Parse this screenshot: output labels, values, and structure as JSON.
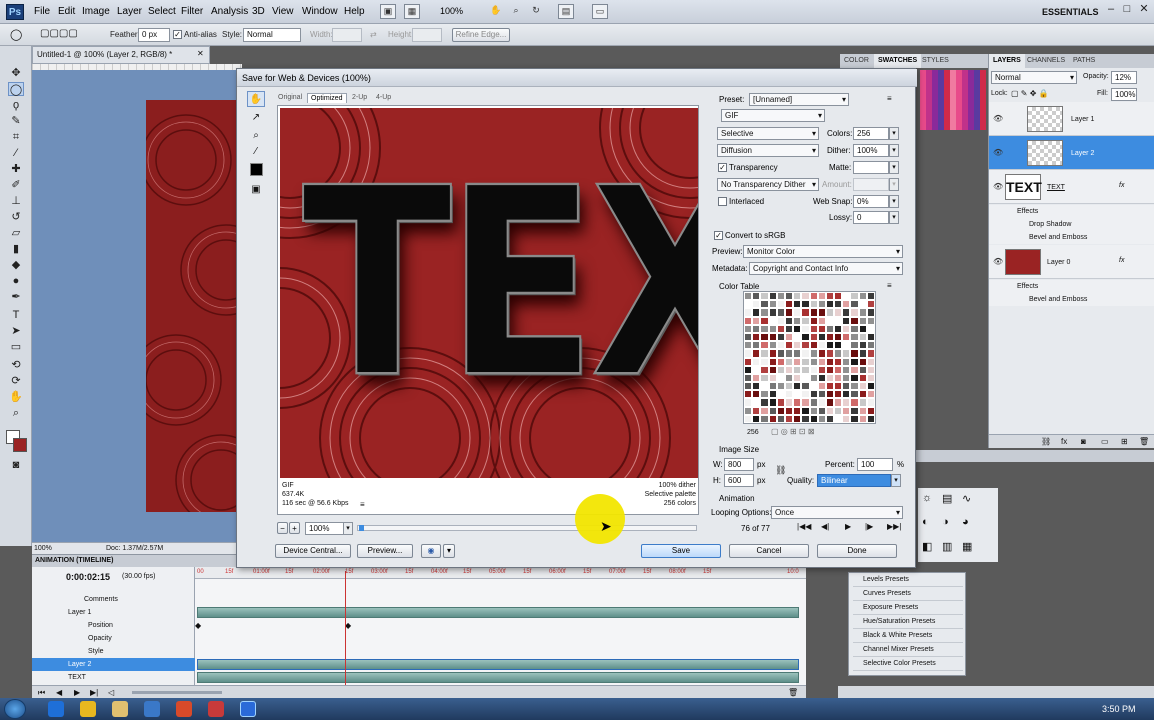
{
  "menubar": {
    "logo": "Ps",
    "items": [
      "File",
      "Edit",
      "Image",
      "Layer",
      "Select",
      "Filter",
      "Analysis",
      "3D",
      "View",
      "Window",
      "Help"
    ],
    "zoom": "100%",
    "workspace": "ESSENTIALS"
  },
  "options": {
    "feather_label": "Feather:",
    "feather_value": "0 px",
    "antialias_label": "Anti-alias",
    "style_label": "Style:",
    "style_value": "Normal",
    "width_label": "Width:",
    "height_label": "Height:",
    "refine_edge": "Refine Edge..."
  },
  "document": {
    "tab": "Untitled-1 @ 100% (Layer 2, RGB/8) *",
    "status_zoom": "100%",
    "status_doc": "Doc: 1.37M/2.57M"
  },
  "animation": {
    "title": "ANIMATION (TIMELINE)",
    "timecode": "0:00:02:15",
    "fps": "(30.00 fps)",
    "ruler_ticks": [
      "00",
      "15f",
      "01:00f",
      "15f",
      "02:00f",
      "15f",
      "03:00f",
      "15f",
      "04:00f",
      "15f",
      "05:00f",
      "15f",
      "06:00f",
      "15f",
      "07:00f",
      "15f",
      "08:00f",
      "15f",
      "10:0"
    ],
    "rows": [
      {
        "label": "Comments",
        "indent": 2
      },
      {
        "label": "Layer 1",
        "indent": 1
      },
      {
        "label": "Position",
        "indent": 2
      },
      {
        "label": "Opacity",
        "indent": 2
      },
      {
        "label": "Style",
        "indent": 2
      },
      {
        "label": "Layer 2",
        "indent": 1
      },
      {
        "label": "TEXT",
        "indent": 1
      }
    ]
  },
  "layers_panel": {
    "tabs": [
      "LAYERS",
      "CHANNELS",
      "PATHS"
    ],
    "blend_mode": "Normal",
    "opacity_label": "Opacity:",
    "opacity_value": "12%",
    "lock_label": "Lock:",
    "fill_label": "Fill:",
    "fill_value": "100%",
    "layers": [
      {
        "name": "Layer 1",
        "selected": false
      },
      {
        "name": "Layer 2",
        "selected": true
      },
      {
        "name": "TEXT",
        "selected": false
      },
      {
        "name": "Layer 0",
        "selected": false
      }
    ],
    "text_effects": [
      "Effects",
      "Drop Shadow",
      "Bevel and Emboss"
    ],
    "layer0_effects": [
      "Effects",
      "Bevel and Emboss"
    ]
  },
  "top_panel_tabs": [
    "COLOR",
    "SWATCHES",
    "STYLES"
  ],
  "adjustments": {
    "presets": [
      "Levels Presets",
      "Curves Presets",
      "Exposure Presets",
      "Hue/Saturation Presets",
      "Black & White Presets",
      "Channel Mixer Presets",
      "Selective Color Presets"
    ]
  },
  "dialog": {
    "title": "Save for Web & Devices (100%)",
    "view_tabs": [
      "Original",
      "Optimized",
      "2-Up",
      "4-Up"
    ],
    "active_tab": "Optimized",
    "preview_text": "TEXT",
    "info_left": [
      "GIF",
      "637.4K",
      "116 sec @ 56.6 Kbps"
    ],
    "info_right": [
      "100% dither",
      "Selective palette",
      "256 colors"
    ],
    "zoom_value": "100%",
    "preset_label": "Preset:",
    "preset_value": "[Unnamed]",
    "format_value": "GIF",
    "reduction_value": "Selective",
    "colors_label": "Colors:",
    "colors_value": "256",
    "dither_algo": "Diffusion",
    "dither_label": "Dither:",
    "dither_value": "100%",
    "transparency_label": "Transparency",
    "matte_label": "Matte:",
    "transp_dither": "No Transparency Dither",
    "amount_label": "Amount:",
    "interlaced_label": "Interlaced",
    "websnap_label": "Web Snap:",
    "websnap_value": "0%",
    "lossy_label": "Lossy:",
    "lossy_value": "0",
    "convert_label": "Convert to sRGB",
    "preview_label": "Preview:",
    "preview_value": "Monitor Color",
    "metadata_label": "Metadata:",
    "metadata_value": "Copyright and Contact Info",
    "color_table_label": "Color Table",
    "color_count": "256",
    "image_size_label": "Image Size",
    "w_label": "W:",
    "w_value": "800",
    "h_label": "H:",
    "h_value": "600",
    "px": "px",
    "percent_label": "Percent:",
    "percent_value": "100",
    "percent_unit": "%",
    "quality_label": "Quality:",
    "quality_value": "Bilinear",
    "animation_label": "Animation",
    "looping_label": "Looping Options:",
    "looping_value": "Once",
    "frame_counter": "76 of 77",
    "device_central": "Device Central...",
    "preview_btn": "Preview...",
    "save_btn": "Save",
    "cancel_btn": "Cancel",
    "done_btn": "Done"
  },
  "taskbar": {
    "clock": "3:50 PM"
  }
}
